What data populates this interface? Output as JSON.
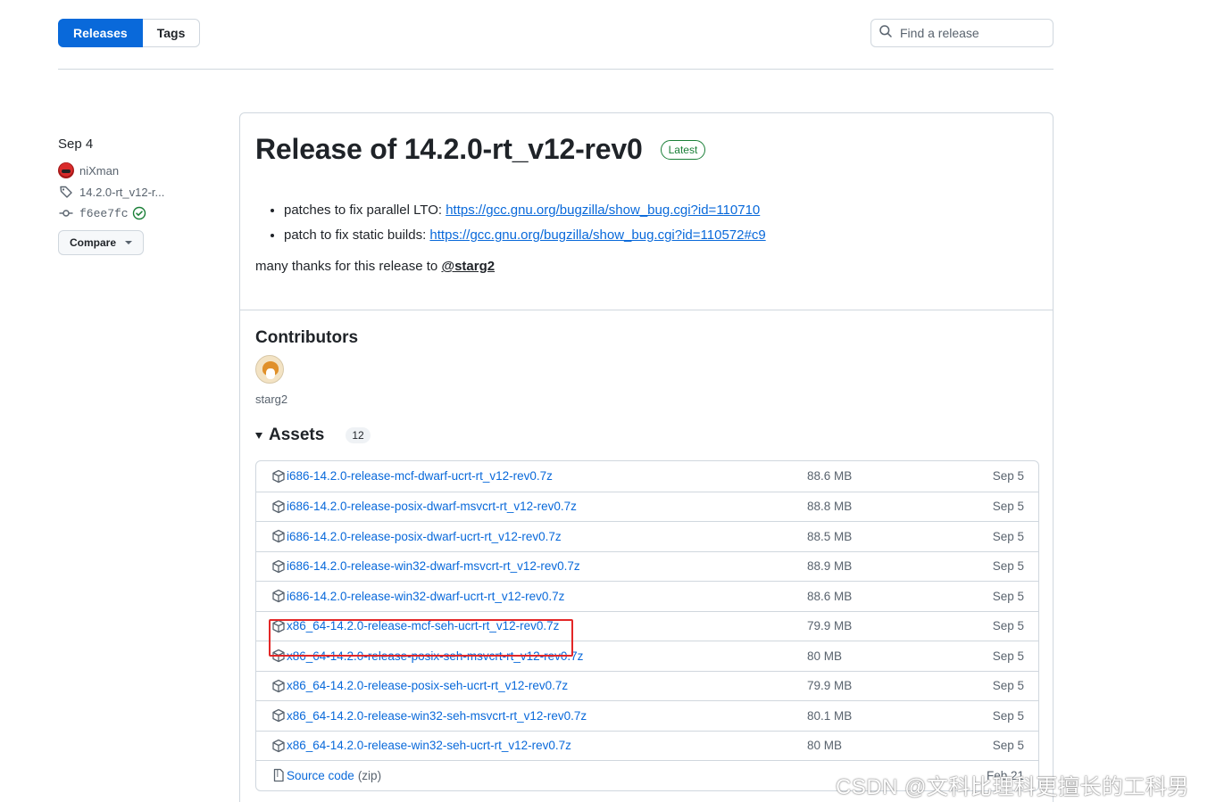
{
  "nav": {
    "releases_label": "Releases",
    "tags_label": "Tags",
    "search_placeholder": "Find a release"
  },
  "sidebar": {
    "date": "Sep 4",
    "author": "niXman",
    "tag": "14.2.0-rt_v12-r...",
    "commit": "f6ee7fc",
    "compare_label": "Compare"
  },
  "release": {
    "title": "Release of 14.2.0-rt_v12-rev0",
    "badge": "Latest",
    "notes": [
      {
        "text": "patches to fix parallel LTO: ",
        "link": "https://gcc.gnu.org/bugzilla/show_bug.cgi?id=110710"
      },
      {
        "text": "patch to fix static builds: ",
        "link": "https://gcc.gnu.org/bugzilla/show_bug.cgi?id=110572#c9"
      }
    ],
    "thanks_text": "many thanks for this release to ",
    "thanks_mention": "@starg2"
  },
  "contributors": {
    "heading": "Contributors",
    "names": [
      "starg2"
    ]
  },
  "assets": {
    "heading": "Assets",
    "count": "12",
    "items": [
      {
        "name": "i686-14.2.0-release-mcf-dwarf-ucrt-rt_v12-rev0.7z",
        "size": "88.6 MB",
        "date": "Sep 5",
        "icon": "package-icon"
      },
      {
        "name": "i686-14.2.0-release-posix-dwarf-msvcrt-rt_v12-rev0.7z",
        "size": "88.8 MB",
        "date": "Sep 5",
        "icon": "package-icon"
      },
      {
        "name": "i686-14.2.0-release-posix-dwarf-ucrt-rt_v12-rev0.7z",
        "size": "88.5 MB",
        "date": "Sep 5",
        "icon": "package-icon"
      },
      {
        "name": "i686-14.2.0-release-win32-dwarf-msvcrt-rt_v12-rev0.7z",
        "size": "88.9 MB",
        "date": "Sep 5",
        "icon": "package-icon"
      },
      {
        "name": "i686-14.2.0-release-win32-dwarf-ucrt-rt_v12-rev0.7z",
        "size": "88.6 MB",
        "date": "Sep 5",
        "icon": "package-icon"
      },
      {
        "name": "x86_64-14.2.0-release-mcf-seh-ucrt-rt_v12-rev0.7z",
        "size": "79.9 MB",
        "date": "Sep 5",
        "icon": "package-icon"
      },
      {
        "name": "x86_64-14.2.0-release-posix-seh-msvcrt-rt_v12-rev0.7z",
        "size": "80 MB",
        "date": "Sep 5",
        "icon": "package-icon"
      },
      {
        "name": "x86_64-14.2.0-release-posix-seh-ucrt-rt_v12-rev0.7z",
        "size": "79.9 MB",
        "date": "Sep 5",
        "icon": "package-icon"
      },
      {
        "name": "x86_64-14.2.0-release-win32-seh-msvcrt-rt_v12-rev0.7z",
        "size": "80.1 MB",
        "date": "Sep 5",
        "icon": "package-icon"
      },
      {
        "name": "x86_64-14.2.0-release-win32-seh-ucrt-rt_v12-rev0.7z",
        "size": "80 MB",
        "date": "Sep 5",
        "icon": "package-icon"
      },
      {
        "name": "Source code",
        "suffix": "(zip)",
        "size": "",
        "date": "Feb 21",
        "icon": "file-zip-icon"
      }
    ]
  },
  "watermark": "CSDN @文科比理科更擅长的工科男",
  "colors": {
    "accent": "#0969da",
    "latest_badge": "#1a7f37",
    "highlight_box": "#e32727",
    "border": "#d0d7de"
  }
}
